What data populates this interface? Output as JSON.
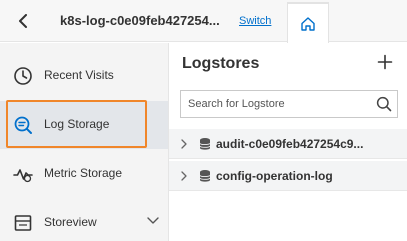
{
  "header": {
    "project_name": "k8s-log-c0e09feb427254...",
    "switch_label": "Switch"
  },
  "sidebar": {
    "items": [
      {
        "label": "Recent Visits",
        "icon": "clock-icon"
      },
      {
        "label": "Log Storage",
        "icon": "log-search-icon",
        "active": true
      },
      {
        "label": "Metric Storage",
        "icon": "metric-icon"
      },
      {
        "label": "Storeview",
        "icon": "storeview-icon"
      }
    ]
  },
  "main": {
    "title": "Logstores",
    "search": {
      "placeholder": "Search for Logstore",
      "value": ""
    },
    "logstores": [
      {
        "name": "audit-c0e09feb427254c9..."
      },
      {
        "name": "config-operation-log"
      }
    ]
  },
  "colors": {
    "highlight": "#f0862a",
    "link": "#0070cc",
    "sidebar_bg": "#f4f4f4",
    "active_item_bg": "#e3e6ea"
  }
}
